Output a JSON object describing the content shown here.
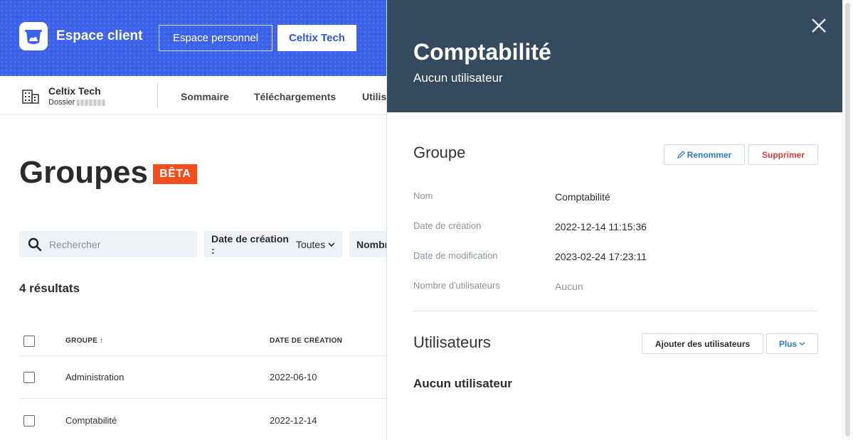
{
  "header": {
    "brand": "Espace client",
    "personal_button": "Espace personnel",
    "company_button": "Celtix Tech"
  },
  "subnav": {
    "company": "Celtix Tech",
    "dossier_label": "Dossier",
    "tabs": [
      "Sommaire",
      "Téléchargements",
      "Utilis"
    ]
  },
  "main": {
    "title": "Groupes",
    "badge": "BÊTA",
    "search_placeholder": "Rechercher",
    "filter_date_label": "Date de création :",
    "filter_date_value": "Toutes",
    "filter_number_label": "Nombr",
    "results": "4 résultats",
    "columns": [
      "GROUPE ↑",
      "DATE DE CRÉATION"
    ],
    "rows": [
      {
        "name": "Administration",
        "date": "2022-06-10"
      },
      {
        "name": "Comptabilité",
        "date": "2022-12-14"
      }
    ]
  },
  "panel": {
    "title": "Comptabilité",
    "subtitle": "Aucun utilisateur",
    "group_section": "Groupe",
    "rename_button": "Renommer",
    "delete_button": "Supprimer",
    "fields": [
      {
        "label": "Nom",
        "value": "Comptabilité"
      },
      {
        "label": "Date de création",
        "value": "2022-12-14 11:15:36"
      },
      {
        "label": "Date de modification",
        "value": "2023-02-24 17:23:11"
      },
      {
        "label": "Nombre d'utilisateurs",
        "value": "Aucun"
      }
    ],
    "users_section": "Utilisateurs",
    "add_users_button": "Ajouter des utilisateurs",
    "more_button": "Plus",
    "empty_text": "Aucun utilisateur"
  },
  "colors": {
    "banner": "#3b62e8",
    "panel_header": "#344a5e",
    "badge": "#f24e1e",
    "link_blue": "#2b7bd6",
    "danger_red": "#d9413b"
  }
}
